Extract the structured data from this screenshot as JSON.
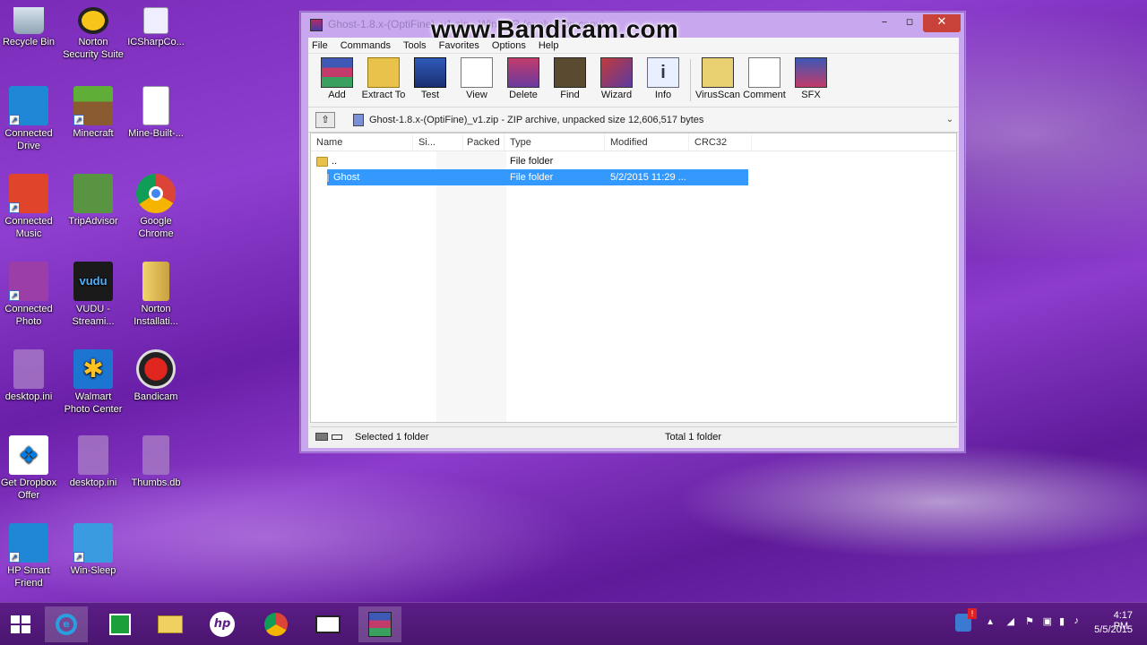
{
  "watermark": "www.Bandicam.com",
  "window": {
    "title": "Ghost-1.8.x-(OptiFine)_v1.zip - WinRAR (evaluation copy)",
    "menu": [
      "File",
      "Commands",
      "Tools",
      "Favorites",
      "Options",
      "Help"
    ],
    "toolbar": [
      "Add",
      "Extract To",
      "Test",
      "View",
      "Delete",
      "Find",
      "Wizard",
      "Info",
      "VirusScan",
      "Comment",
      "SFX"
    ],
    "address": "Ghost-1.8.x-(OptiFine)_v1.zip - ZIP archive, unpacked size 12,606,517 bytes",
    "columns": [
      "Name",
      "Si...",
      "Packed",
      "Type",
      "Modified",
      "CRC32"
    ],
    "rows": [
      {
        "name": "..",
        "size": "",
        "packed": "",
        "type": "File folder",
        "modified": "",
        "crc": ""
      },
      {
        "name": "Ghost",
        "size": "",
        "packed": "",
        "type": "File folder",
        "modified": "5/2/2015 11:29 ...",
        "crc": ""
      }
    ],
    "status_left": "Selected 1 folder",
    "status_right": "Total 1 folder"
  },
  "desktop_icons": [
    {
      "label": "Recycle Bin",
      "icon": "recycle-bin-icon"
    },
    {
      "label": "Norton Security Suite",
      "icon": "norton-icon"
    },
    {
      "label": "ICSharpCo...",
      "icon": "file-icon"
    },
    {
      "label": "Connected Drive",
      "icon": "cloud-drive-icon"
    },
    {
      "label": "Minecraft",
      "icon": "minecraft-icon"
    },
    {
      "label": "Mine-Built-...",
      "icon": "document-icon"
    },
    {
      "label": "Connected Music",
      "icon": "music-icon"
    },
    {
      "label": "TripAdvisor",
      "icon": "tripadvisor-icon"
    },
    {
      "label": "Google Chrome",
      "icon": "chrome-icon"
    },
    {
      "label": "Connected Photo",
      "icon": "photo-icon"
    },
    {
      "label": "VUDU - Streami...",
      "icon": "vudu-icon"
    },
    {
      "label": "Norton Installati...",
      "icon": "norton-installer-icon"
    },
    {
      "label": "desktop.ini",
      "icon": "settings-file-icon"
    },
    {
      "label": "Walmart Photo Center",
      "icon": "walmart-icon"
    },
    {
      "label": "Bandicam",
      "icon": "bandicam-icon"
    },
    {
      "label": "Get Dropbox Offer",
      "icon": "dropbox-icon"
    },
    {
      "label": "desktop.ini",
      "icon": "settings-file-icon"
    },
    {
      "label": "Thumbs.db",
      "icon": "db-file-icon"
    },
    {
      "label": "HP Smart Friend",
      "icon": "hp-support-icon"
    },
    {
      "label": "Win-Sleep",
      "icon": "folder-icon"
    }
  ],
  "taskbar": {
    "apps": [
      "start-icon",
      "ie-icon",
      "store-icon",
      "file-explorer-icon",
      "hp-icon",
      "chrome-icon",
      "video-icon",
      "winrar-icon"
    ],
    "time": "4:17 PM",
    "date": "5/5/2015"
  },
  "colors": {
    "selection": "#3399ff",
    "close": "#c8423a"
  }
}
